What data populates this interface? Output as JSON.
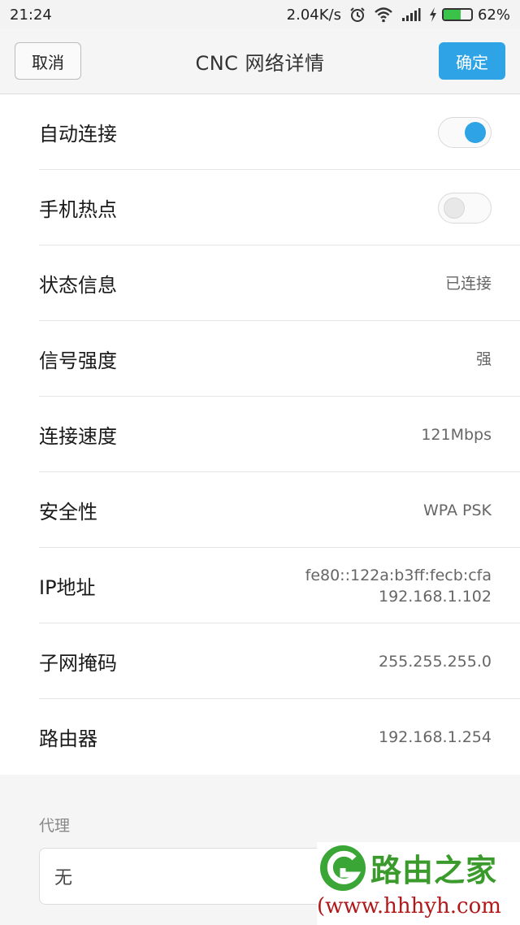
{
  "status_bar": {
    "time": "21:24",
    "net_speed": "2.04K/s",
    "battery_percent": "62%",
    "battery_level": 0.62,
    "icons": [
      "alarm-icon",
      "wifi-icon",
      "signal-icon",
      "charging-icon",
      "battery-icon"
    ]
  },
  "header": {
    "cancel_label": "取消",
    "title": "CNC  网络详情",
    "confirm_label": "确定",
    "accent_color": "#2ea3e6"
  },
  "settings": {
    "auto_connect": {
      "label": "自动连接",
      "enabled": true
    },
    "hotspot": {
      "label": "手机热点",
      "enabled": false
    },
    "status": {
      "label": "状态信息",
      "value": "已连接"
    },
    "signal": {
      "label": "信号强度",
      "value": "强"
    },
    "speed": {
      "label": "连接速度",
      "value": "121Mbps"
    },
    "security": {
      "label": "安全性",
      "value": "WPA PSK"
    },
    "ip": {
      "label": "IP地址",
      "value_ipv6": "fe80::122a:b3ff:fecb:cfa",
      "value_ipv4": "192.168.1.102"
    },
    "subnet": {
      "label": "子网掩码",
      "value": "255.255.255.0"
    },
    "router": {
      "label": "路由器",
      "value": "192.168.1.254"
    }
  },
  "proxy": {
    "label": "代理",
    "value": "无"
  },
  "watermark": {
    "title": "路由之家",
    "url": "(www.hhhyh.com"
  }
}
